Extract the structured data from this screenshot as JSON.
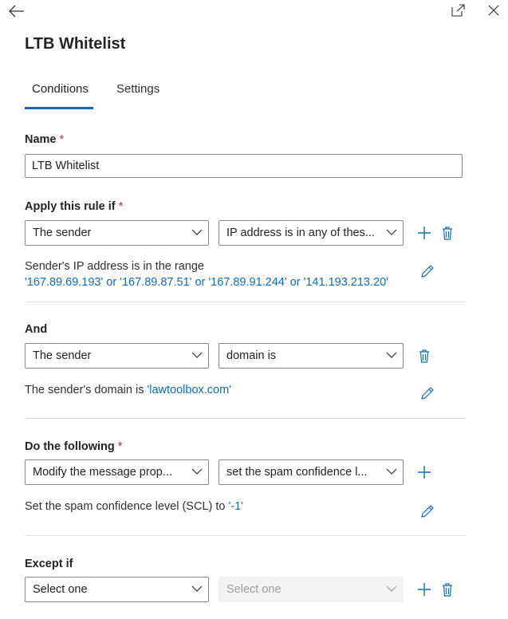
{
  "window": {
    "back_icon": "arrow-left-icon",
    "popout_icon": "popout-icon",
    "close_icon": "close-icon"
  },
  "header": {
    "title": "LTB Whitelist"
  },
  "tabs": [
    {
      "label": "Conditions",
      "active": true
    },
    {
      "label": "Settings",
      "active": false
    }
  ],
  "name_field": {
    "label": "Name",
    "required_mark": "*",
    "value": "LTB Whitelist"
  },
  "apply_rule": {
    "label": "Apply this rule if",
    "required_mark": "*",
    "dropdown1": "The sender",
    "dropdown2": "IP address is in any of thes...",
    "description": "Sender's IP address is in the range",
    "value": "'167.89.69.193' or '167.89.87.51' or '167.89.91.244' or '141.193.213.20'"
  },
  "and_rule": {
    "label": "And",
    "dropdown1": "The sender",
    "dropdown2": "domain is",
    "description": "The sender's domain is",
    "value": "'lawtoolbox.com'"
  },
  "action": {
    "label": "Do the following",
    "required_mark": "*",
    "dropdown1": "Modify the message prop...",
    "dropdown2": "set the spam confidence l...",
    "description": "Set the spam confidence level (SCL) to",
    "value": "'-1'"
  },
  "except": {
    "label": "Except if",
    "dropdown1": "Select one",
    "dropdown2": "Select one"
  },
  "colors": {
    "accent": "#0f6cbd",
    "required": "#c4314b",
    "divider": "#e1dfdd"
  }
}
